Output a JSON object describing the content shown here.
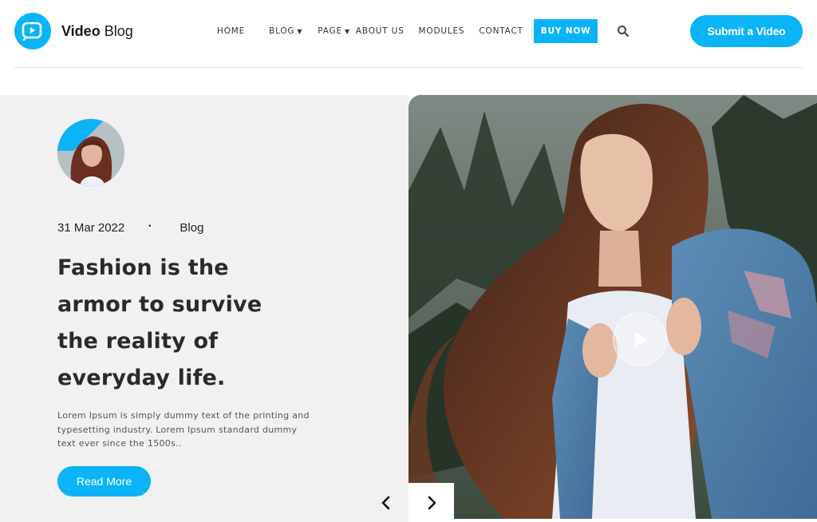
{
  "brand": {
    "name_bold": "Video",
    "name_rest": " Blog",
    "accent_color": "#0ab4f6"
  },
  "nav": {
    "items": [
      {
        "label": "HOME",
        "has_dropdown": false
      },
      {
        "label": "BLOG",
        "has_dropdown": true
      },
      {
        "label": "PAGE",
        "has_dropdown": true
      },
      {
        "label": "ABOUT US",
        "has_dropdown": false
      },
      {
        "label": "MODULES",
        "has_dropdown": false
      },
      {
        "label": "CONTACT",
        "has_dropdown": false
      }
    ],
    "buy_now": "BUY NOW",
    "search_icon": "search-icon"
  },
  "header": {
    "submit_label": "Submit a Video"
  },
  "post": {
    "date": "31 Mar 2022",
    "separator": "•",
    "category": "Blog",
    "title_lines": [
      "Fashion is the",
      "armor to survive",
      "the reality of",
      "everyday life."
    ],
    "excerpt": "Lorem Ipsum is simply dummy text of the printing and typesetting industry. Lorem Ipsum standard dummy text ever since the 1500s..",
    "read_more": "Read More"
  },
  "slider": {
    "prev_icon": "chevron-left-icon",
    "next_icon": "chevron-right-icon"
  },
  "hero": {
    "play_icon": "play-icon"
  }
}
